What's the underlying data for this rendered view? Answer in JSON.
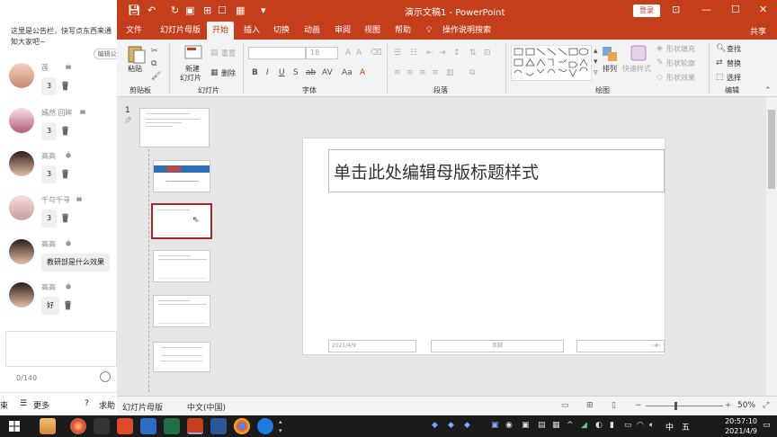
{
  "chat": {
    "notice": "这里是公告栏，快写点东西来通知大家吧~",
    "edit_label": "编辑公",
    "messages": [
      {
        "name": "莲",
        "text": "3",
        "os": "android"
      },
      {
        "name": "嫣然 回眸",
        "text": "3",
        "os": "android"
      },
      {
        "name": "高高",
        "text": "3",
        "os": "apple"
      },
      {
        "name": "千与千寻",
        "text": "3",
        "os": "android"
      },
      {
        "name": "高高",
        "text": "教研部是什么效果",
        "os": "apple"
      },
      {
        "name": "高高",
        "text": "好",
        "os": "apple"
      }
    ],
    "input_placeholder": "",
    "counter": "0/140",
    "bottom": {
      "left": "束",
      "more": "更多",
      "help": "求助"
    }
  },
  "window": {
    "title": "演示文稿1  -  PowerPoint",
    "login": "登录",
    "controls": {
      "minimize": "—",
      "restore": "☐",
      "close": "✕"
    }
  },
  "tabs": [
    {
      "label": "文件"
    },
    {
      "label": "幻灯片母版"
    },
    {
      "label": "开始",
      "active": true
    },
    {
      "label": "插入"
    },
    {
      "label": "切换"
    },
    {
      "label": "动画"
    },
    {
      "label": "审阅"
    },
    {
      "label": "视图"
    },
    {
      "label": "帮助"
    },
    {
      "label": "操作说明搜索"
    }
  ],
  "share": "共享",
  "ribbon": {
    "clipboard": {
      "paste": "粘贴",
      "group": "剪贴板"
    },
    "slides": {
      "new_slide": "新建\n幻灯片",
      "new_slide_l1": "新建",
      "new_slide_l2": "幻灯片",
      "reset": "重置",
      "delete": "删除",
      "group": "幻灯片"
    },
    "font": {
      "group": "字体",
      "size": "18"
    },
    "paragraph": {
      "group": "段落"
    },
    "drawing": {
      "arrange": "排列",
      "quick_styles": "快速样式",
      "fill": "形状填充",
      "outline": "形状轮廓",
      "effect": "形状效果",
      "group": "绘图"
    },
    "editing": {
      "find": "查找",
      "replace": "替换",
      "select": "选择",
      "group": "编辑"
    }
  },
  "slide_number": "1",
  "slide": {
    "title": "单击此处编辑母版标题样式",
    "footer_date": "2021/4/9",
    "footer_center": "页脚",
    "footer_num": "‹#›"
  },
  "statusbar": {
    "view": "幻灯片母版",
    "language": "中文(中国)",
    "zoom": "50%"
  },
  "taskbar": {
    "time": "20:57:10",
    "date": "2021/4/9",
    "ime": "中",
    "ime2": "五"
  }
}
